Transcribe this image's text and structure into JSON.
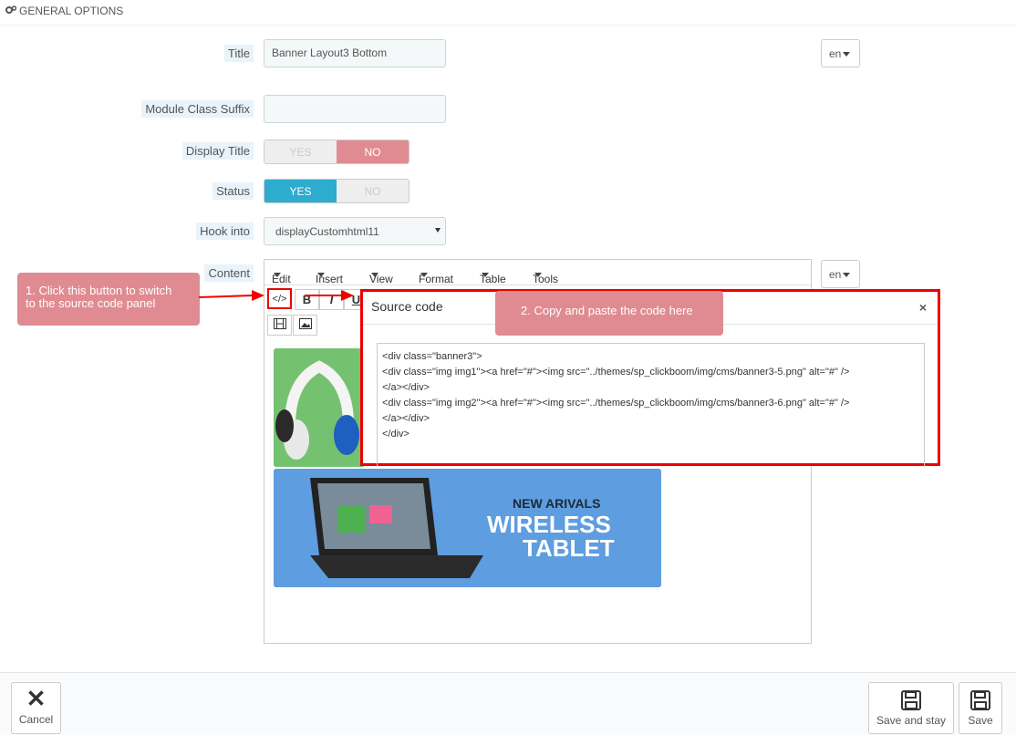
{
  "panel": {
    "heading": "GENERAL OPTIONS",
    "icon": "gears-icon"
  },
  "form": {
    "title": {
      "label": "Title",
      "value": "Banner Layout3 Bottom",
      "lang": "en"
    },
    "module_class_suffix": {
      "label": "Module Class Suffix",
      "value": ""
    },
    "display_title": {
      "label": "Display Title",
      "yes": "YES",
      "no": "NO",
      "selected": "NO"
    },
    "status": {
      "label": "Status",
      "yes": "YES",
      "no": "NO",
      "selected": "YES"
    },
    "hook_into": {
      "label": "Hook into",
      "value": "displayCustomhtml11"
    },
    "content": {
      "label": "Content",
      "lang": "en"
    }
  },
  "editor": {
    "menu": [
      "Edit",
      "Insert",
      "View",
      "Format",
      "Table",
      "Tools"
    ],
    "toolbar": {
      "source_code": "</>",
      "bold": "B",
      "italic": "I",
      "underline": "U"
    },
    "banner2": {
      "line1": "NEW ARIVALS",
      "line2": "WIRELESS",
      "line3": "TABLET"
    }
  },
  "source_modal": {
    "title": "Source code",
    "close": "×",
    "code_lines": [
      "<div class=\"banner3\">",
      "<div class=\"img img1\"><a href=\"#\"><img src=\"../themes/sp_clickboom/img/cms/banner3-5.png\" alt=\"#\" />",
      "</a></div>",
      "<div class=\"img img2\"><a href=\"#\"><img src=\"../themes/sp_clickboom/img/cms/banner3-6.png\" alt=\"#\" />",
      "</a></div>",
      "</div>"
    ]
  },
  "callouts": {
    "step1_line1": "1. Click this button to switch",
    "step1_line2": "to the source code panel",
    "step2": "2. Copy and paste the code here"
  },
  "footer": {
    "cancel": "Cancel",
    "save_and_stay": "Save and stay",
    "save": "Save"
  },
  "colors": {
    "accent_yes": "#2eacce",
    "accent_no": "#e08b91",
    "highlight": "#e00000",
    "banner_green": "#6cbf6c",
    "banner_blue": "#5b9bd5"
  }
}
